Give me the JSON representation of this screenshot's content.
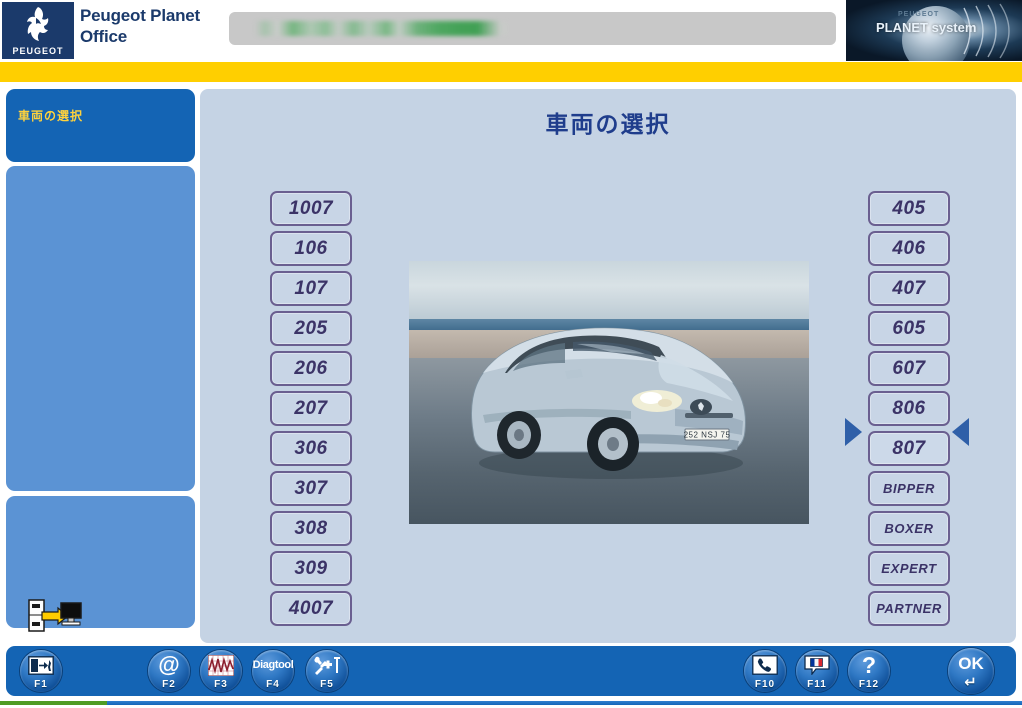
{
  "header": {
    "brand_mark": "peugeot-lion",
    "brand_word": "PEUGEOT",
    "app_title": "Peugeot Planet Office",
    "redacted_field_note": "",
    "planet_logo": {
      "sub": "PEUGEOT",
      "main": "PLANET system"
    }
  },
  "sidebar": {
    "panels": [
      {
        "label": "車両の選択",
        "state": "active"
      },
      {
        "label": "",
        "state": "idle"
      },
      {
        "label": "",
        "state": "idle"
      }
    ],
    "transfer_icon": "data-transfer-to-pc-icon"
  },
  "main": {
    "title": "車両の選択",
    "selected_model": "807",
    "left_models": [
      "1007",
      "106",
      "107",
      "205",
      "206",
      "207",
      "306",
      "307",
      "308",
      "309",
      "4007"
    ],
    "right_models": [
      "405",
      "406",
      "407",
      "605",
      "607",
      "806",
      "807",
      "BIPPER",
      "BOXER",
      "EXPERT",
      "PARTNER"
    ],
    "vehicle_image": {
      "description": "Silver Peugeot 807 MPV parked on a wet beach",
      "license_plate": "252 NSJ 75"
    }
  },
  "toolbar": {
    "buttons": [
      {
        "key": "F1",
        "glyph": "↱",
        "name": "exit-icon",
        "label": "F1"
      },
      {
        "key": "F2",
        "glyph": "@",
        "name": "email-icon",
        "label": "F2"
      },
      {
        "key": "F3",
        "glyph": "⌇",
        "name": "waveform-icon",
        "label": "F3"
      },
      {
        "key": "F4",
        "glyph": "Diagtool",
        "name": "diagtool-icon",
        "label": "F4"
      },
      {
        "key": "F5",
        "glyph": "⚒",
        "name": "tools-icon",
        "label": "F5"
      },
      {
        "key": "F10",
        "glyph": "☎",
        "name": "phone-icon",
        "label": "F10"
      },
      {
        "key": "F11",
        "glyph": "flag",
        "name": "language-flag-icon",
        "label": "F11"
      },
      {
        "key": "F12",
        "glyph": "?",
        "name": "help-icon",
        "label": "F12"
      },
      {
        "key": "OK",
        "glyph": "OK",
        "name": "ok-icon",
        "label": "↵"
      }
    ]
  },
  "status": {
    "green_segment": "",
    "blue_segment": ""
  },
  "colors": {
    "brand_navy": "#1b3a6b",
    "accent_yellow": "#ffcf00",
    "panel_blue_active": "#1464b4",
    "panel_blue_idle": "#5b93d4",
    "card_bg": "#c5d3e4",
    "title_blue": "#1f3d8c",
    "button_border": "#6a5f90",
    "button_text": "#3b3367",
    "sidebar_label_yellow": "#ffd23c",
    "status_green": "#4f9c24"
  }
}
